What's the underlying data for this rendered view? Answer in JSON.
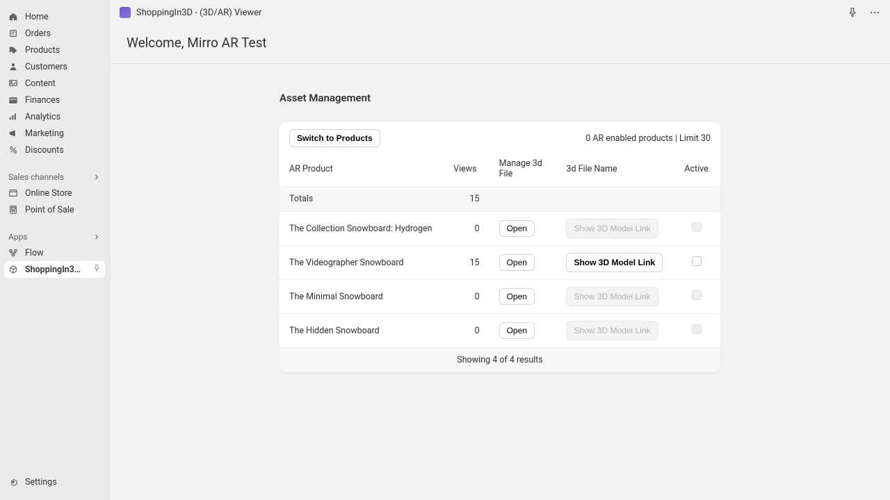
{
  "sidebar": {
    "nav": [
      {
        "label": "Home",
        "icon": "home"
      },
      {
        "label": "Orders",
        "icon": "orders"
      },
      {
        "label": "Products",
        "icon": "products"
      },
      {
        "label": "Customers",
        "icon": "customers"
      },
      {
        "label": "Content",
        "icon": "content"
      },
      {
        "label": "Finances",
        "icon": "finances"
      },
      {
        "label": "Analytics",
        "icon": "analytics"
      },
      {
        "label": "Marketing",
        "icon": "marketing"
      },
      {
        "label": "Discounts",
        "icon": "discounts"
      }
    ],
    "sales_header": "Sales channels",
    "sales": [
      {
        "label": "Online Store",
        "icon": "store"
      },
      {
        "label": "Point of Sale",
        "icon": "pos"
      }
    ],
    "apps_header": "Apps",
    "apps": [
      {
        "label": "Flow",
        "icon": "flow"
      },
      {
        "label": "ShoppingIn3D - (3D/A...",
        "icon": "box3d",
        "active": true,
        "pinned": true
      }
    ],
    "settings_label": "Settings"
  },
  "topbar": {
    "title": "ShoppingIn3D - (3D/AR) Viewer"
  },
  "welcome": "Welcome, Mirro AR Test",
  "section_title": "Asset Management",
  "card": {
    "switch_label": "Switch to Products",
    "limit_text": "0 AR enabled products | Limit 30",
    "columns": {
      "product": "AR Product",
      "views": "Views",
      "manage": "Manage 3d File",
      "filename": "3d File Name",
      "active": "Active"
    },
    "totals_label": "Totals",
    "totals_views": "15",
    "open_label": "Open",
    "link_label": "Show 3D Model Link",
    "rows": [
      {
        "name": "The Collection Snowboard: Hydrogen",
        "views": "0",
        "has_link": false
      },
      {
        "name": "The Videographer Snowboard",
        "views": "15",
        "has_link": true
      },
      {
        "name": "The Minimal Snowboard",
        "views": "0",
        "has_link": false
      },
      {
        "name": "The Hidden Snowboard",
        "views": "0",
        "has_link": false
      }
    ],
    "pagination": "Showing 4 of 4 results"
  }
}
